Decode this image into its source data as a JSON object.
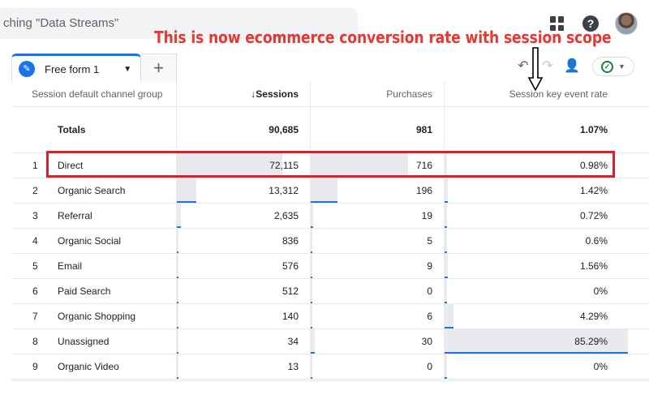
{
  "search": {
    "text": "ching \"Data Streams\""
  },
  "annotation": {
    "text": "This is now ecommerce conversion rate with session scope",
    "color": "#e53935"
  },
  "tab": {
    "label": "Free form 1",
    "add": "+"
  },
  "colors": {
    "accent": "#1a73e8",
    "highlight": "#e01e2b",
    "bar": "#e8eaed"
  },
  "table": {
    "headers": {
      "dimension": "Session default channel group",
      "sessions": "Sessions",
      "purchases": "Purchases",
      "rate": "Session key event rate"
    },
    "sort_indicator": "↓",
    "totals": {
      "label": "Totals",
      "sessions": "90,685",
      "purchases": "981",
      "rate": "1.07%"
    },
    "rows": [
      {
        "idx": "1",
        "channel": "Direct",
        "sessions": "72,115",
        "purchases": "716",
        "rate": "0.98%",
        "sessions_share": 0.795,
        "purchases_share": 0.73,
        "rate_share": 0.0115
      },
      {
        "idx": "2",
        "channel": "Organic Search",
        "sessions": "13,312",
        "purchases": "196",
        "rate": "1.42%",
        "sessions_share": 0.147,
        "purchases_share": 0.2,
        "rate_share": 0.0167
      },
      {
        "idx": "3",
        "channel": "Referral",
        "sessions": "2,635",
        "purchases": "19",
        "rate": "0.72%",
        "sessions_share": 0.029,
        "purchases_share": 0.019,
        "rate_share": 0.0084
      },
      {
        "idx": "4",
        "channel": "Organic Social",
        "sessions": "836",
        "purchases": "5",
        "rate": "0.6%",
        "sessions_share": 0.009,
        "purchases_share": 0.005,
        "rate_share": 0.007
      },
      {
        "idx": "5",
        "channel": "Email",
        "sessions": "576",
        "purchases": "9",
        "rate": "1.56%",
        "sessions_share": 0.006,
        "purchases_share": 0.009,
        "rate_share": 0.018
      },
      {
        "idx": "6",
        "channel": "Paid Search",
        "sessions": "512",
        "purchases": "0",
        "rate": "0%",
        "sessions_share": 0.006,
        "purchases_share": 0,
        "rate_share": 0
      },
      {
        "idx": "7",
        "channel": "Organic Shopping",
        "sessions": "140",
        "purchases": "6",
        "rate": "4.29%",
        "sessions_share": 0.002,
        "purchases_share": 0.006,
        "rate_share": 0.05
      },
      {
        "idx": "8",
        "channel": "Unassigned",
        "sessions": "34",
        "purchases": "30",
        "rate": "85.29%",
        "sessions_share": 0.0004,
        "purchases_share": 0.031,
        "rate_share": 1.0
      },
      {
        "idx": "9",
        "channel": "Organic Video",
        "sessions": "13",
        "purchases": "0",
        "rate": "0%",
        "sessions_share": 0.0001,
        "purchases_share": 0,
        "rate_share": 0
      }
    ]
  }
}
